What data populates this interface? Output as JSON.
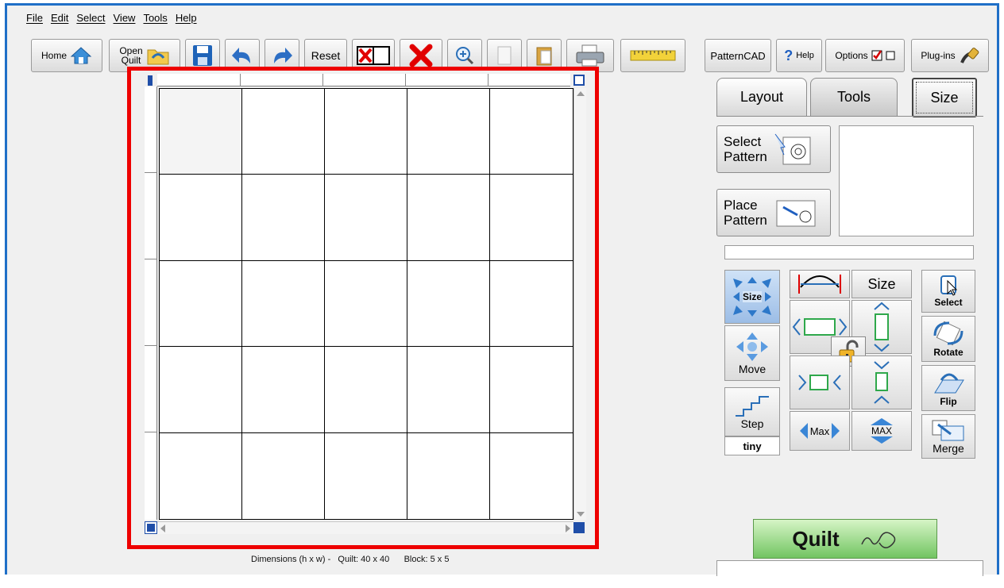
{
  "menu": [
    "File",
    "Edit",
    "Select",
    "View",
    "Tools",
    "Help"
  ],
  "toolbar": {
    "home": "Home",
    "open_line1": "Open",
    "open_line2": "Quilt",
    "reset": "Reset",
    "patterncad": "PatternCAD",
    "help_q": "?",
    "help": "Help",
    "options": "Options",
    "plugins": "Plug-ins"
  },
  "tabs": {
    "layout": "Layout",
    "tools": "Tools",
    "size": "Size"
  },
  "patterns": {
    "select_line1": "Select",
    "select_line2": "Pattern",
    "place_line1": "Place",
    "place_line2": "Pattern"
  },
  "tools": {
    "size_icon_label": "Size",
    "size": "Size",
    "move": "Move",
    "step": "Step",
    "step_value": "tiny",
    "max": "Max",
    "max_vertical": "MAX",
    "select": "Select",
    "rotate": "Rotate",
    "flip": "Flip",
    "merge": "Merge"
  },
  "quilt_button": "Quilt",
  "status": {
    "dimensions_label": "Dimensions (h x w) -",
    "quilt": "Quilt: 40 x 40",
    "block": "Block: 5 x 5"
  },
  "quilt_grid": {
    "rows": 5,
    "cols": 5
  },
  "colors": {
    "highlight_border": "#ee0000",
    "window_border": "#1f6fc7",
    "quilt_button": "#72c462"
  }
}
